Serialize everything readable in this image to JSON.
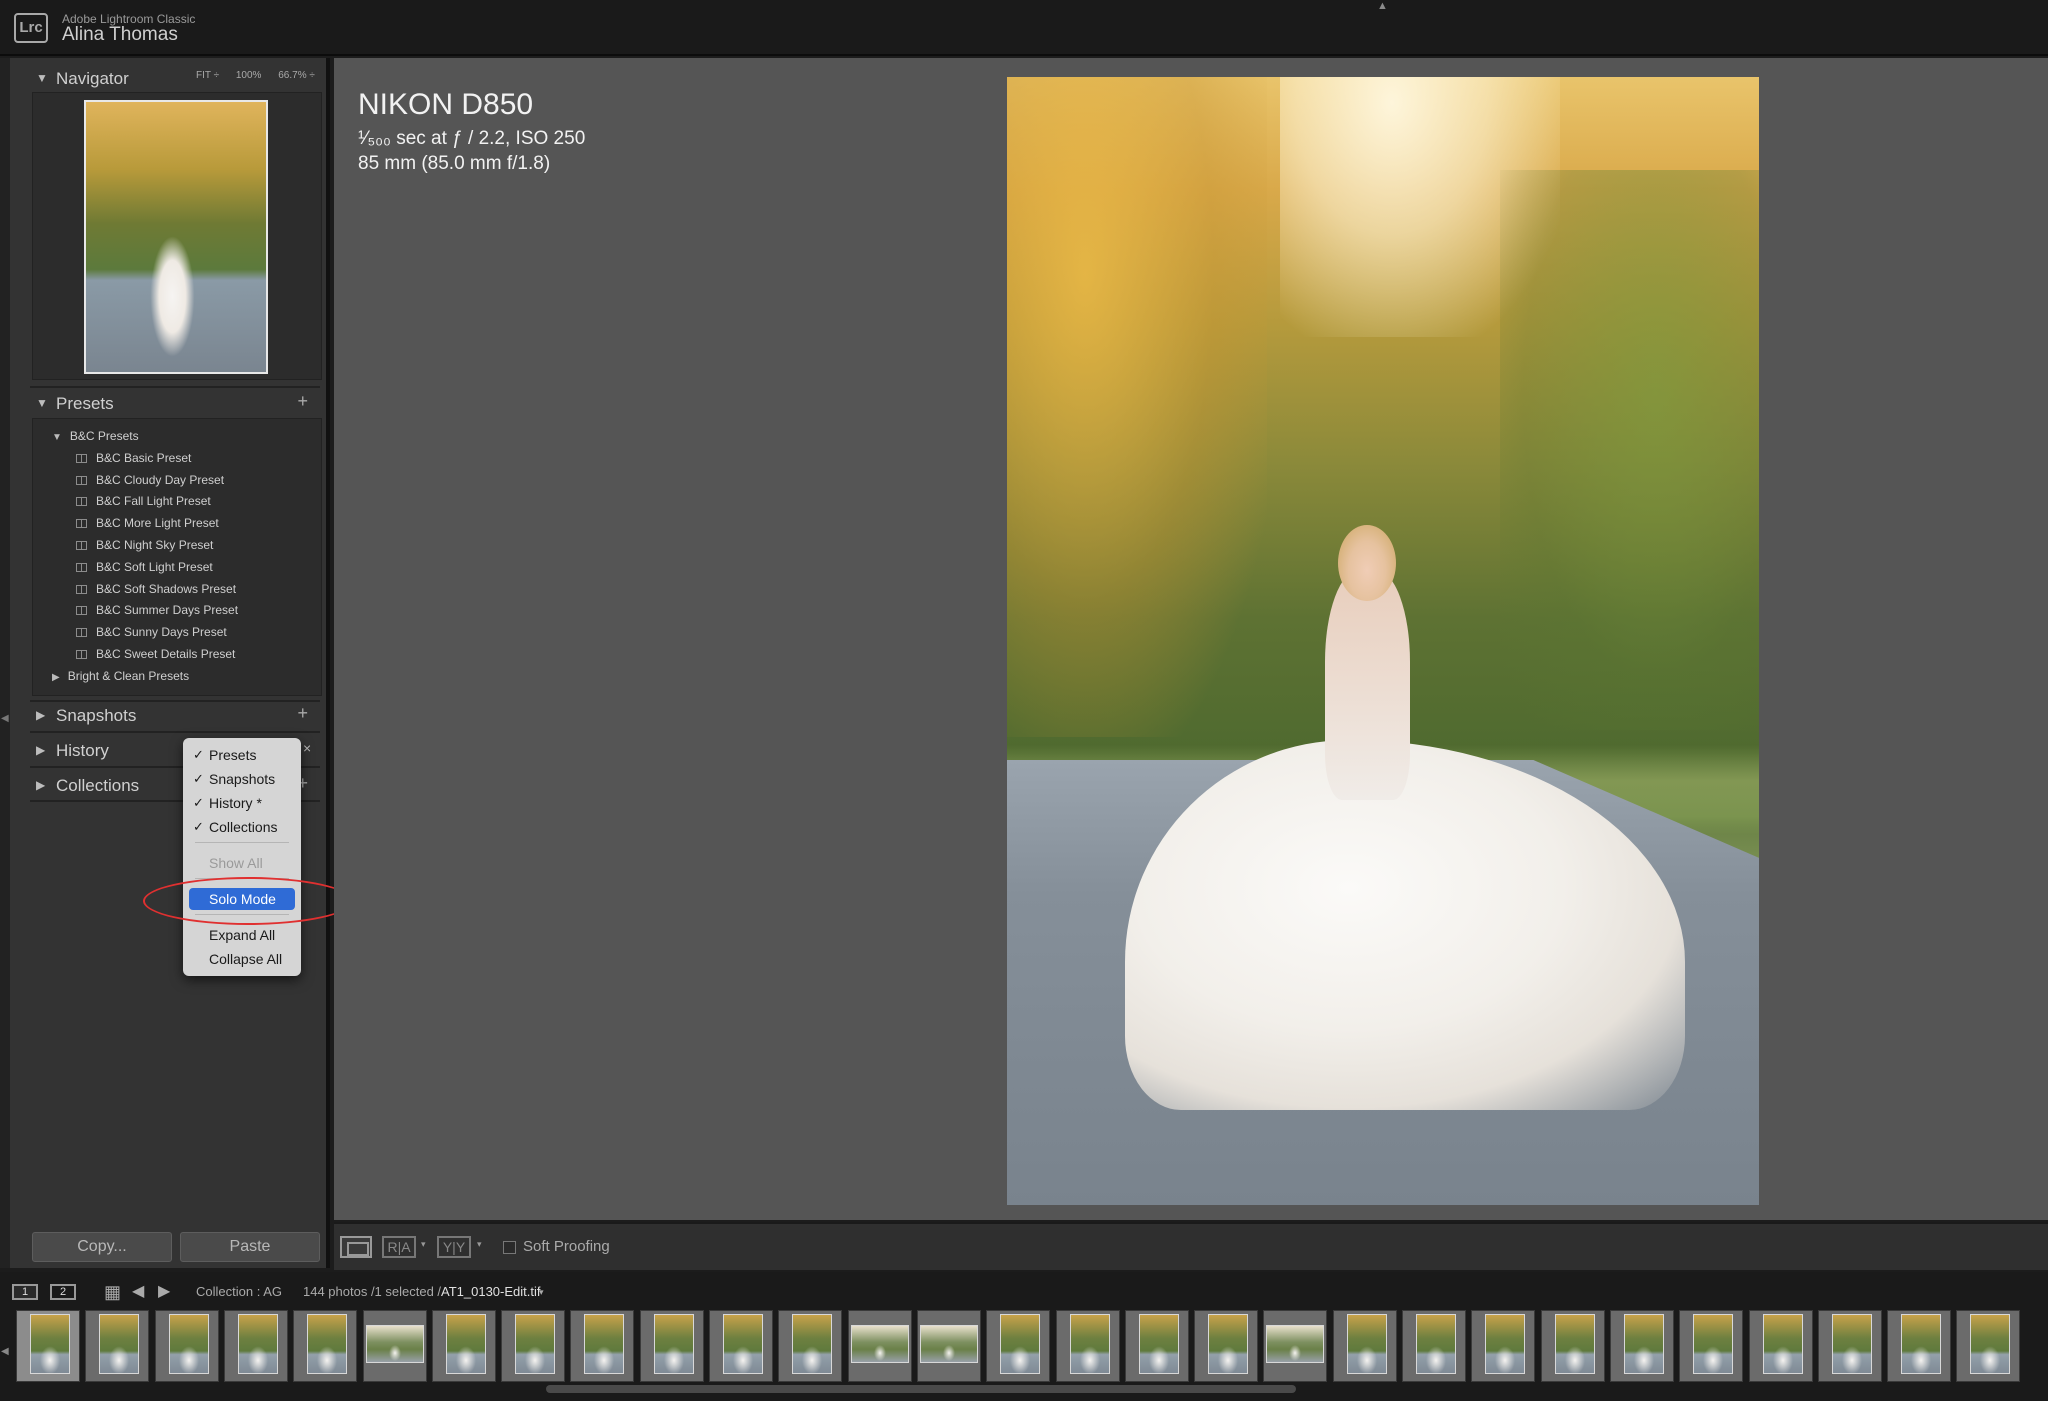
{
  "app": {
    "name": "Adobe Lightroom Classic",
    "user": "Alina Thomas",
    "logo": "Lrc"
  },
  "navigator": {
    "title": "Navigator",
    "zoom_options": [
      "FIT ÷",
      "100%",
      "66.7% ÷"
    ]
  },
  "presets": {
    "title": "Presets",
    "groups": [
      {
        "label": "B&C Presets",
        "expanded": true,
        "items": [
          "B&C Basic Preset",
          "B&C Cloudy Day Preset",
          "B&C Fall Light Preset",
          "B&C More Light Preset",
          "B&C Night Sky Preset",
          "B&C Soft Light Preset",
          "B&C Soft Shadows Preset",
          "B&C Summer Days Preset",
          "B&C Sunny Days Preset",
          "B&C Sweet Details Preset"
        ]
      },
      {
        "label": "Bright & Clean Presets",
        "expanded": false,
        "items": []
      }
    ]
  },
  "panels": {
    "snapshots": "Snapshots",
    "history": "History",
    "collections": "Collections"
  },
  "context_menu": {
    "items": [
      {
        "label": "Presets",
        "checked": true
      },
      {
        "label": "Snapshots",
        "checked": true
      },
      {
        "label": "History *",
        "checked": true
      },
      {
        "label": "Collections",
        "checked": true
      },
      {
        "label": "Show All",
        "disabled": true
      },
      {
        "label": "Solo Mode",
        "highlighted": true
      },
      {
        "label": "Expand All"
      },
      {
        "label": "Collapse All"
      }
    ],
    "check_glyph": "✓"
  },
  "buttons": {
    "copy": "Copy...",
    "paste": "Paste"
  },
  "photo_info": {
    "camera": "NIKON D850",
    "exposure": "¹⁄₅₀₀ sec at ƒ / 2.2, ISO 250",
    "lens": "85 mm (85.0 mm f/1.8)"
  },
  "toolbar": {
    "ra": "R|A",
    "yy": "Y|Y",
    "soft_proofing": "Soft Proofing",
    "soft_proofing_checked": false
  },
  "filmstrip": {
    "screen1": "1",
    "screen2": "2",
    "source": "Collection : AG",
    "count": "144 photos /1 selected /",
    "filename": "AT1_0130-Edit.tif",
    "thumbs": [
      "v",
      "v",
      "v",
      "v",
      "v",
      "h",
      "v",
      "v",
      "v",
      "v",
      "v",
      "v",
      "h",
      "h",
      "v",
      "v",
      "v",
      "v",
      "h",
      "v",
      "v",
      "v",
      "v",
      "v",
      "v",
      "v",
      "v",
      "v",
      "v"
    ]
  },
  "icons": {
    "triangle_down": "▼",
    "triangle_right": "▶",
    "plus": "+",
    "close": "×",
    "grid": "▦",
    "back": "◀",
    "forward": "▶",
    "caret": "▾"
  },
  "colors": {
    "accent": "#2f6bd6",
    "annotation": "#e03030",
    "panel_bg": "#333333",
    "canvas_bg": "#555555"
  }
}
